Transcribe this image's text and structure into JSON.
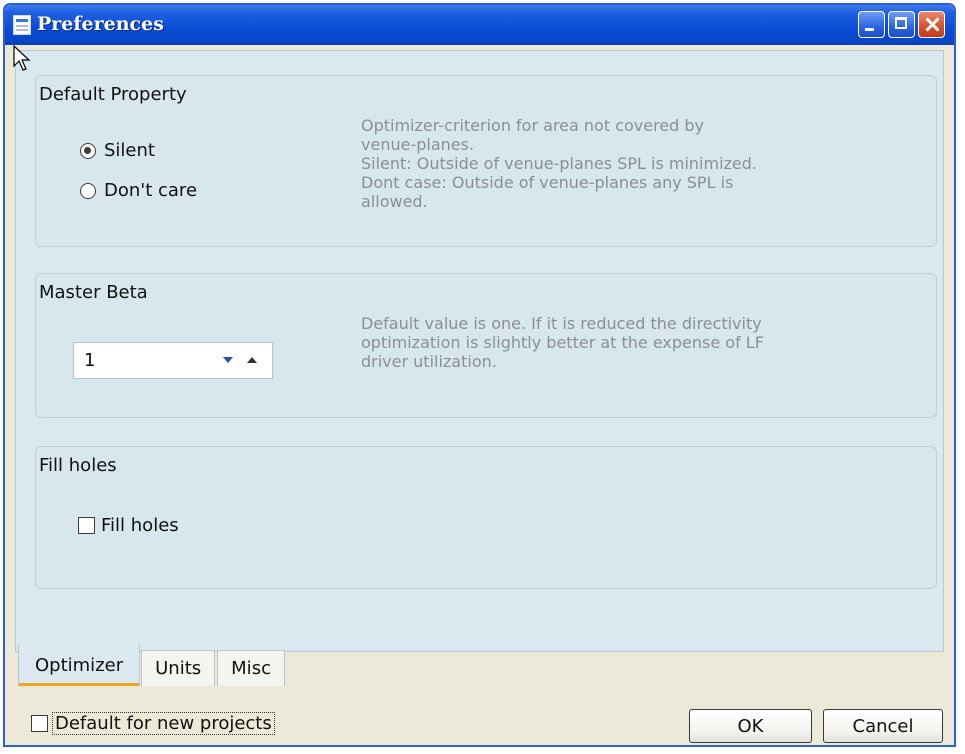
{
  "window": {
    "title": "Preferences"
  },
  "default_property": {
    "group_title": "Default Property",
    "options": [
      {
        "label": "Silent",
        "selected": true
      },
      {
        "label": "Don't care",
        "selected": false
      }
    ],
    "description_lines": [
      "Optimizer-criterion for area not covered by",
      "venue-planes.",
      "Silent: Outside of venue-planes SPL is minimized.",
      "Dont case: Outside of venue-planes any SPL is",
      "allowed."
    ]
  },
  "master_beta": {
    "group_title": "Master Beta",
    "value": "1",
    "description_lines": [
      "Default value is one. If it is reduced the directivity",
      "optimization is slightly better at the expense of LF",
      "driver utilization."
    ]
  },
  "fill_holes": {
    "group_title": "Fill holes",
    "checkbox_label": "Fill holes",
    "checked": false
  },
  "tabs": [
    {
      "label": "Optimizer",
      "active": true
    },
    {
      "label": "Units",
      "active": false
    },
    {
      "label": "Misc",
      "active": false
    }
  ],
  "footer": {
    "default_checkbox_label": "Default for new projects",
    "default_checked": false,
    "ok_label": "OK",
    "cancel_label": "Cancel"
  },
  "colors": {
    "titlebar": "#0a4bd6",
    "panel_background": "#dbe8ef",
    "description_text": "#8a8f93",
    "active_tab_underline": "#e8a520",
    "close_button": "#d8502c"
  },
  "icons": {
    "window": "document-icon",
    "minimize": "minimize-icon",
    "maximize": "maximize-icon",
    "close": "close-icon",
    "spin_down": "chevron-down-icon",
    "spin_up": "chevron-up-icon",
    "cursor": "mouse-pointer-icon"
  }
}
